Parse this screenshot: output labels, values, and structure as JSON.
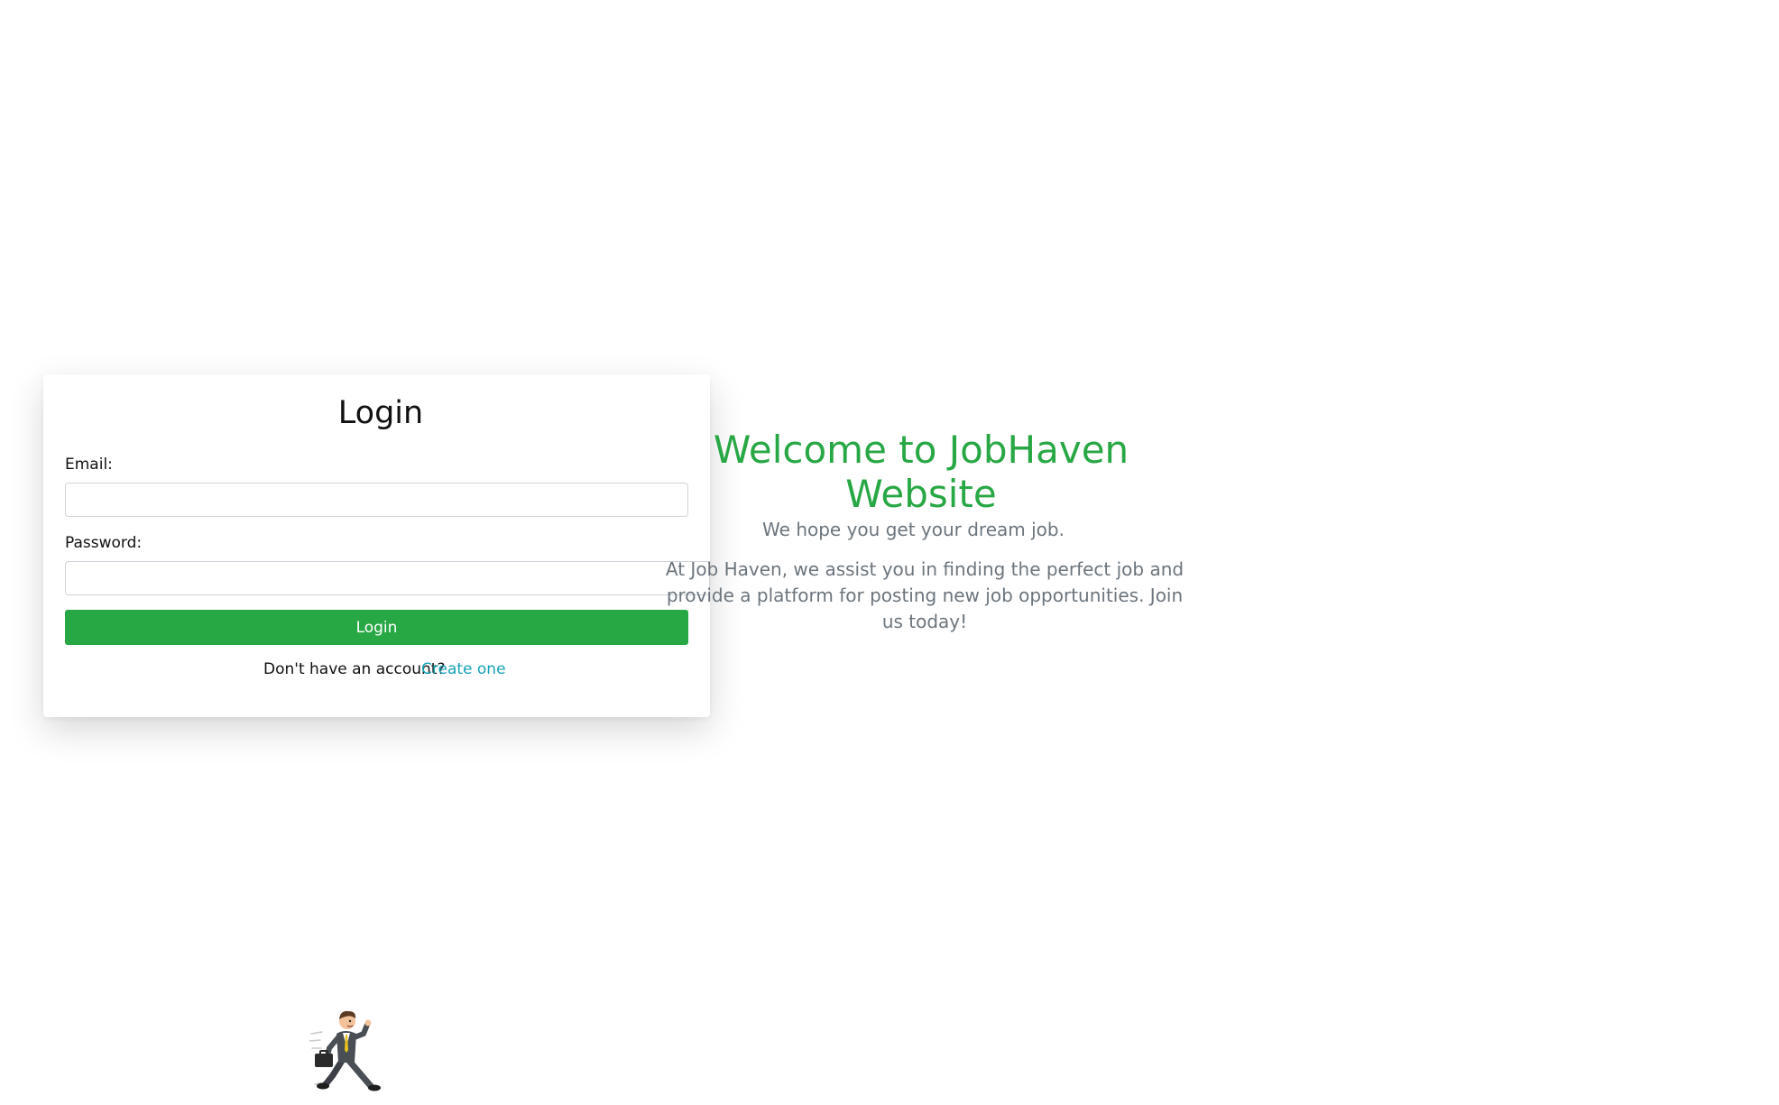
{
  "login": {
    "title": "Login",
    "email_label": "Email:",
    "email_value": "",
    "password_label": "Password:",
    "password_value": "",
    "submit_label": "Login",
    "no_account_text": "Don't have an account?",
    "create_link": "Create one"
  },
  "welcome": {
    "title": "Welcome to JobHaven Website",
    "subtitle": "We hope you get your dream job.",
    "description": "At Job Haven, we assist you in finding the perfect job and provide a platform for posting new job opportunities. Join us today!"
  },
  "mascot": {
    "icon": "businessman-running-icon"
  },
  "colors": {
    "accent": "#28a745",
    "link": "#17a2b8",
    "muted_text": "#6c757d"
  }
}
